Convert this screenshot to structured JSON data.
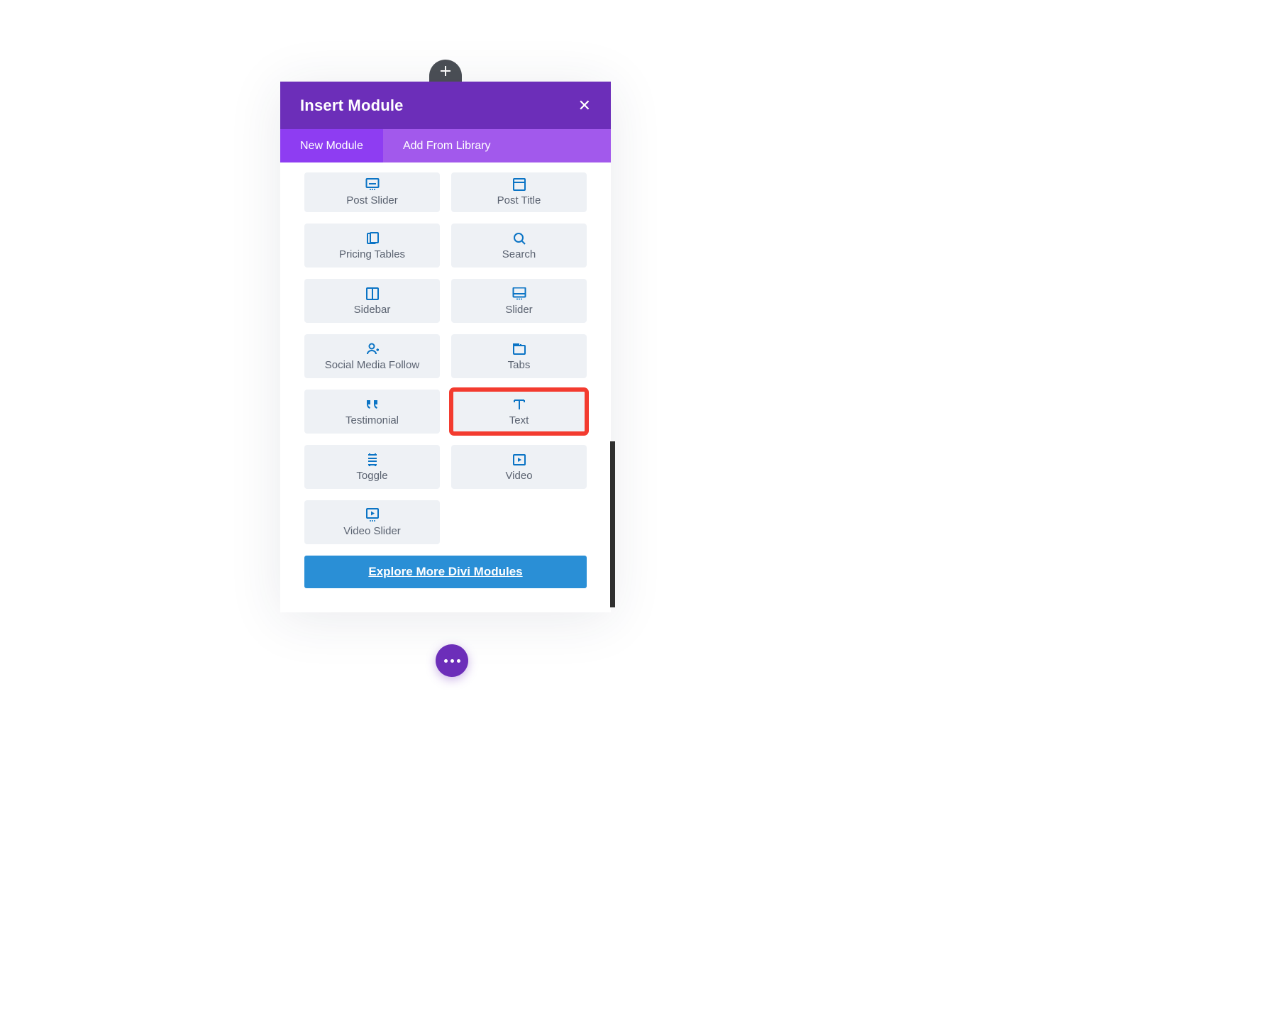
{
  "modal": {
    "title": "Insert Module",
    "close_glyph": "✕"
  },
  "tabs": {
    "new_module": "New Module",
    "add_from_library": "Add From Library"
  },
  "modules": {
    "post_slider": "Post Slider",
    "post_title": "Post Title",
    "pricing_tables": "Pricing Tables",
    "search": "Search",
    "sidebar": "Sidebar",
    "slider": "Slider",
    "social_media_follow": "Social Media Follow",
    "tabs": "Tabs",
    "testimonial": "Testimonial",
    "text": "Text",
    "toggle": "Toggle",
    "video": "Video",
    "video_slider": "Video Slider"
  },
  "highlighted_module": "text",
  "explore_button": "Explore More Divi Modules",
  "colors": {
    "brand_purple": "#6c2eb9",
    "tabs_purple": "#a259ec",
    "active_tab_purple": "#8e3df2",
    "card_bg": "#eef1f5",
    "icon_blue": "#0b74c5",
    "cta_blue": "#2a8fd6",
    "highlight_red": "#f33b2f"
  }
}
